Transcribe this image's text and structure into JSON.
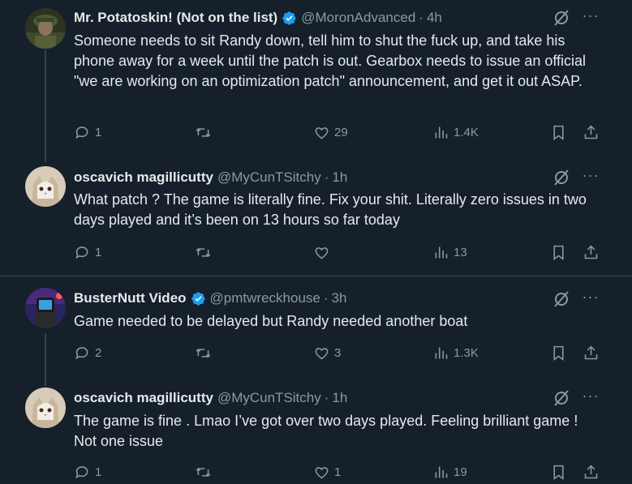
{
  "tweets": [
    {
      "name": "Mr. Potatoskin! (Not on the list)",
      "handle": "@MoronAdvanced",
      "time": "4h",
      "verified": true,
      "text": "Someone needs to sit Randy down, tell him to shut the fuck up, and take his phone away for a week until the patch is out. Gearbox needs to issue an official \"we are working on an optimization patch\" announcement, and get it out ASAP.",
      "replies": "1",
      "reposts": "",
      "likes": "29",
      "views": "1.4K"
    },
    {
      "name": "oscavich magillicutty",
      "handle": "@MyCunTSitchy",
      "time": "1h",
      "verified": false,
      "text": "What patch ? The game is literally fine. Fix your shit. Literally zero issues in two days played and it’s been on 13 hours so far today",
      "replies": "1",
      "reposts": "",
      "likes": "",
      "views": "13"
    },
    {
      "name": "BusterNutt Video",
      "handle": "@pmtwreckhouse",
      "time": "3h",
      "verified": true,
      "text": "Game needed to be delayed but Randy needed another boat",
      "replies": "2",
      "reposts": "",
      "likes": "3",
      "views": "1.3K"
    },
    {
      "name": "oscavich magillicutty",
      "handle": "@MyCunTSitchy",
      "time": "1h",
      "verified": false,
      "text": "The game is fine . Lmao I’ve got over two days played. Feeling brilliant game ! Not one issue",
      "replies": "1",
      "reposts": "",
      "likes": "1",
      "views": "19"
    }
  ],
  "ui": {
    "dot": "·",
    "more": "···"
  },
  "colors": {
    "background": "#15202b",
    "verified": "#1d9bf0",
    "muted": "#8b98a5",
    "border": "#38444d"
  }
}
